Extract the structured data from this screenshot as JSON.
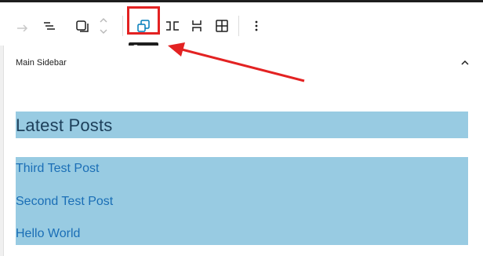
{
  "toolbar": {
    "tooltip": "Group",
    "icons": [
      "redo-icon",
      "list-view-icon",
      "select-parent-icon",
      "move-up-down-icon",
      "group-icon",
      "row-icon",
      "stack-icon",
      "grid-icon",
      "more-options-icon"
    ]
  },
  "panel": {
    "title": "Main Sidebar"
  },
  "content": {
    "heading": "Latest Posts",
    "posts": [
      "Third Test Post",
      "Second Test Post",
      "Hello World"
    ]
  },
  "colors": {
    "accent": "#007cba",
    "highlight_fill": "#98cbe2",
    "annotation": "#e32222",
    "link": "#1a6eb6"
  }
}
